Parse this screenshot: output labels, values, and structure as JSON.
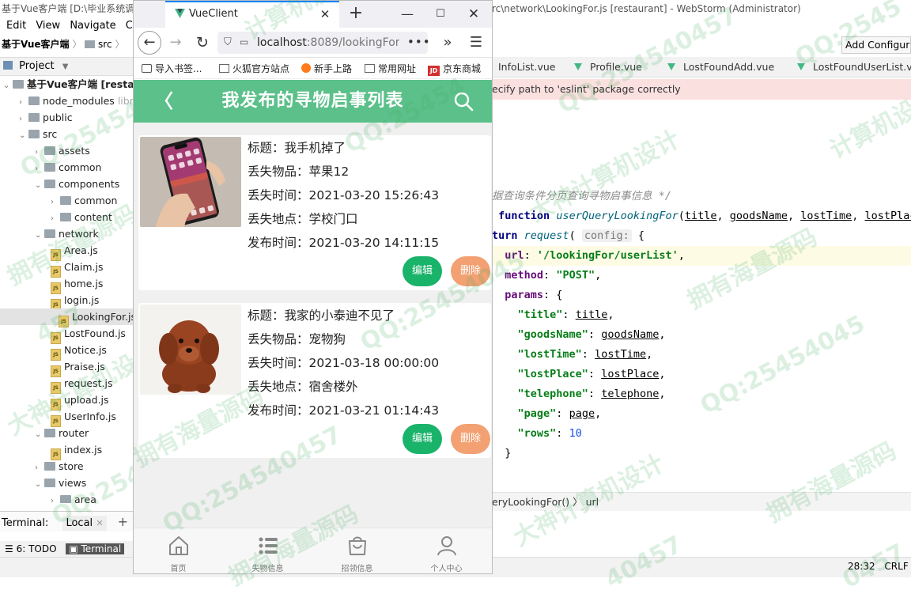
{
  "ide": {
    "title_left": "基于Vue客户端 [D:\\毕业系统调",
    "title_right": "rc\\network\\LookingFor.js [restaurant] - WebStorm (Administrator)",
    "menu": [
      "Edit",
      "View",
      "Navigate",
      "Co"
    ],
    "breadcrumb_root": "基于Vue客户端",
    "breadcrumb_src": "src",
    "project_label": "Project",
    "tree": [
      {
        "label": "基于Vue客户端 [restaurant]",
        "type": "root"
      },
      {
        "label": "node_modules",
        "extra": "library root",
        "type": "folder"
      },
      {
        "label": "public",
        "type": "folder"
      },
      {
        "label": "src",
        "type": "folder"
      },
      {
        "label": "assets",
        "type": "folder"
      },
      {
        "label": "common",
        "type": "folder"
      },
      {
        "label": "components",
        "type": "folder"
      },
      {
        "label": "common",
        "type": "folder"
      },
      {
        "label": "content",
        "type": "folder"
      },
      {
        "label": "network",
        "type": "folder"
      },
      {
        "label": "Area.js",
        "type": "file"
      },
      {
        "label": "Claim.js",
        "type": "file"
      },
      {
        "label": "home.js",
        "type": "file"
      },
      {
        "label": "login.js",
        "type": "file"
      },
      {
        "label": "LookingFor.js",
        "type": "file"
      },
      {
        "label": "LostFound.js",
        "type": "file"
      },
      {
        "label": "Notice.js",
        "type": "file"
      },
      {
        "label": "Praise.js",
        "type": "file"
      },
      {
        "label": "request.js",
        "type": "file"
      },
      {
        "label": "upload.js",
        "type": "file"
      },
      {
        "label": "UserInfo.js",
        "type": "file"
      },
      {
        "label": "router",
        "type": "folder"
      },
      {
        "label": "index.js",
        "type": "file"
      },
      {
        "label": "store",
        "type": "folder"
      },
      {
        "label": "views",
        "type": "folder"
      },
      {
        "label": "area",
        "type": "folder"
      }
    ],
    "terminal_label": "Terminal:",
    "terminal_tab": "Local",
    "todo_label": "6: TODO",
    "terminal_tool": "Terminal",
    "add_config": "Add Configura",
    "editor_tabs": [
      "InfoList.vue",
      "Profile.vue",
      "LostFoundAdd.vue",
      "LostFoundUserList.vu"
    ],
    "eslint_banner": "ecify path to 'eslint' package correctly",
    "code_comment": "据查询条件分页查询寻物启事信息 */",
    "code_bread": "eryLookingFor()  〉 url",
    "status_pos": "28:32",
    "status_crlf": "CRLF"
  },
  "watermark": {
    "qq": "QQ:25454045",
    "qq2": "QQ:254540457",
    "qq3": "QQ:2545",
    "qq4": "QQ:25454",
    "own": "拥有海量源码",
    "design": "大神计算机设计",
    "design_part": "计算机设计",
    "num": "40457",
    "num2": "0457",
    "num3": "457"
  },
  "browser": {
    "tab_title": "VueClient",
    "url_host": "localhost",
    "url_rest": ":8089/lookingFor",
    "url_more": "•••",
    "bookmarks": [
      "导入书签...",
      "火狐官方站点",
      "新手上路",
      "常用网址",
      "京东商城"
    ]
  },
  "app": {
    "title": "我发布的寻物启事列表",
    "items": [
      {
        "title_label": "标题：",
        "title": "我手机掉了",
        "goods_label": "丢失物品：",
        "goods": "苹果12",
        "time_label": "丢失时间：",
        "time": "2021-03-20 15:26:43",
        "place_label": "丢失地点：",
        "place": "学校门口",
        "pub_label": "发布时间：",
        "pub": "2021-03-20 14:11:15",
        "edit": "编辑",
        "delete": "删除"
      },
      {
        "title_label": "标题：",
        "title": "我家的小泰迪不见了",
        "goods_label": "丢失物品：",
        "goods": "宠物狗",
        "time_label": "丢失时间：",
        "time": "2021-03-18 00:00:00",
        "place_label": "丢失地点：",
        "place": "宿舍楼外",
        "pub_label": "发布时间：",
        "pub": "2021-03-21 01:14:43",
        "edit": "编辑",
        "delete": "删除"
      }
    ],
    "tabbar": [
      "首页",
      "失物信息",
      "招领信息",
      "个人中心"
    ]
  }
}
